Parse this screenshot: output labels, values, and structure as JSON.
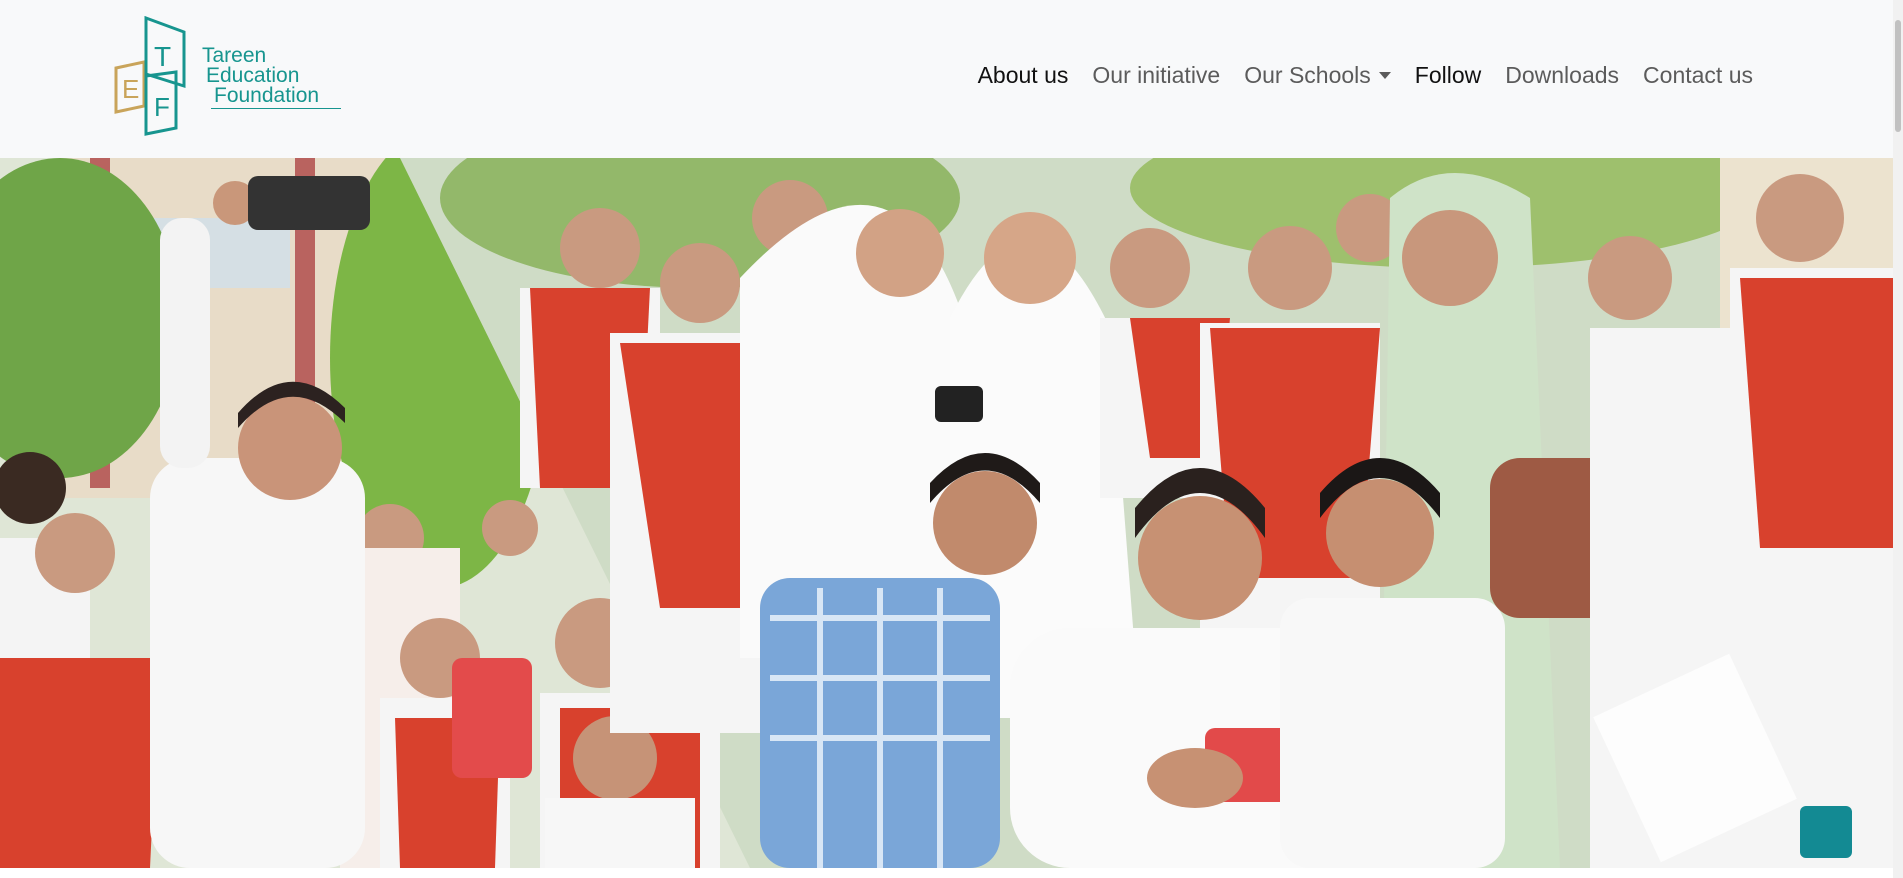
{
  "brand": {
    "logo_letters": [
      "E",
      "T",
      "F"
    ],
    "name_line1": "Tareen",
    "name_line2": "Education",
    "name_line3": "Foundation",
    "colors": {
      "teal": "#17958f",
      "gold": "#c9a45a"
    }
  },
  "nav": {
    "items": [
      {
        "label": "About us",
        "active": true
      },
      {
        "label": "Our initiative",
        "active": false
      },
      {
        "label": "Our Schools",
        "active": false,
        "dropdown": true
      },
      {
        "label": "Follow",
        "active": true
      },
      {
        "label": "Downloads",
        "active": false
      },
      {
        "label": "Contact us",
        "active": false
      }
    ]
  },
  "hero": {
    "description_icon": "photo-collage-students-selfie"
  },
  "back_to_top": {
    "icon": "back-to-top-icon",
    "color": "#138a93"
  }
}
